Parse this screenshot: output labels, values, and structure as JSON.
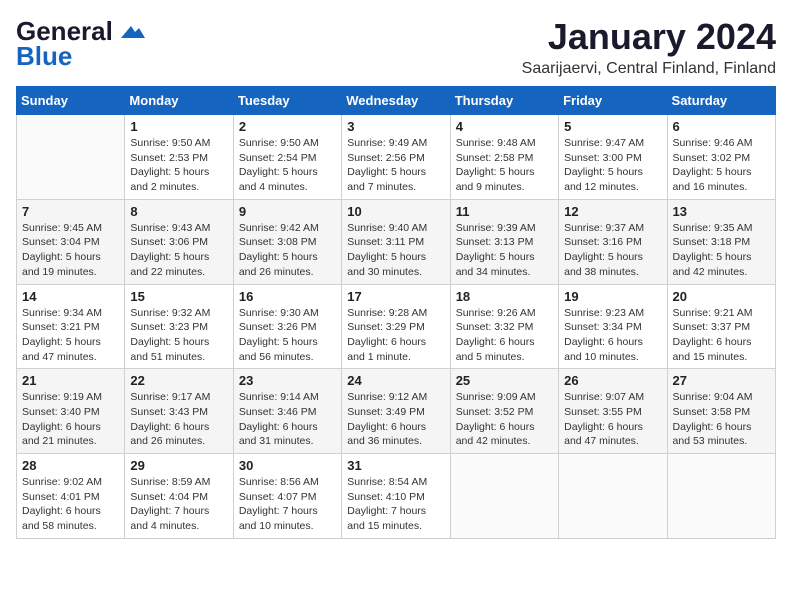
{
  "header": {
    "logo_general": "General",
    "logo_blue": "Blue",
    "main_title": "January 2024",
    "subtitle": "Saarijaervi, Central Finland, Finland"
  },
  "calendar": {
    "days_of_week": [
      "Sunday",
      "Monday",
      "Tuesday",
      "Wednesday",
      "Thursday",
      "Friday",
      "Saturday"
    ],
    "weeks": [
      [
        {
          "day": "",
          "info": ""
        },
        {
          "day": "1",
          "info": "Sunrise: 9:50 AM\nSunset: 2:53 PM\nDaylight: 5 hours\nand 2 minutes."
        },
        {
          "day": "2",
          "info": "Sunrise: 9:50 AM\nSunset: 2:54 PM\nDaylight: 5 hours\nand 4 minutes."
        },
        {
          "day": "3",
          "info": "Sunrise: 9:49 AM\nSunset: 2:56 PM\nDaylight: 5 hours\nand 7 minutes."
        },
        {
          "day": "4",
          "info": "Sunrise: 9:48 AM\nSunset: 2:58 PM\nDaylight: 5 hours\nand 9 minutes."
        },
        {
          "day": "5",
          "info": "Sunrise: 9:47 AM\nSunset: 3:00 PM\nDaylight: 5 hours\nand 12 minutes."
        },
        {
          "day": "6",
          "info": "Sunrise: 9:46 AM\nSunset: 3:02 PM\nDaylight: 5 hours\nand 16 minutes."
        }
      ],
      [
        {
          "day": "7",
          "info": "Sunrise: 9:45 AM\nSunset: 3:04 PM\nDaylight: 5 hours\nand 19 minutes."
        },
        {
          "day": "8",
          "info": "Sunrise: 9:43 AM\nSunset: 3:06 PM\nDaylight: 5 hours\nand 22 minutes."
        },
        {
          "day": "9",
          "info": "Sunrise: 9:42 AM\nSunset: 3:08 PM\nDaylight: 5 hours\nand 26 minutes."
        },
        {
          "day": "10",
          "info": "Sunrise: 9:40 AM\nSunset: 3:11 PM\nDaylight: 5 hours\nand 30 minutes."
        },
        {
          "day": "11",
          "info": "Sunrise: 9:39 AM\nSunset: 3:13 PM\nDaylight: 5 hours\nand 34 minutes."
        },
        {
          "day": "12",
          "info": "Sunrise: 9:37 AM\nSunset: 3:16 PM\nDaylight: 5 hours\nand 38 minutes."
        },
        {
          "day": "13",
          "info": "Sunrise: 9:35 AM\nSunset: 3:18 PM\nDaylight: 5 hours\nand 42 minutes."
        }
      ],
      [
        {
          "day": "14",
          "info": "Sunrise: 9:34 AM\nSunset: 3:21 PM\nDaylight: 5 hours\nand 47 minutes."
        },
        {
          "day": "15",
          "info": "Sunrise: 9:32 AM\nSunset: 3:23 PM\nDaylight: 5 hours\nand 51 minutes."
        },
        {
          "day": "16",
          "info": "Sunrise: 9:30 AM\nSunset: 3:26 PM\nDaylight: 5 hours\nand 56 minutes."
        },
        {
          "day": "17",
          "info": "Sunrise: 9:28 AM\nSunset: 3:29 PM\nDaylight: 6 hours\nand 1 minute."
        },
        {
          "day": "18",
          "info": "Sunrise: 9:26 AM\nSunset: 3:32 PM\nDaylight: 6 hours\nand 5 minutes."
        },
        {
          "day": "19",
          "info": "Sunrise: 9:23 AM\nSunset: 3:34 PM\nDaylight: 6 hours\nand 10 minutes."
        },
        {
          "day": "20",
          "info": "Sunrise: 9:21 AM\nSunset: 3:37 PM\nDaylight: 6 hours\nand 15 minutes."
        }
      ],
      [
        {
          "day": "21",
          "info": "Sunrise: 9:19 AM\nSunset: 3:40 PM\nDaylight: 6 hours\nand 21 minutes."
        },
        {
          "day": "22",
          "info": "Sunrise: 9:17 AM\nSunset: 3:43 PM\nDaylight: 6 hours\nand 26 minutes."
        },
        {
          "day": "23",
          "info": "Sunrise: 9:14 AM\nSunset: 3:46 PM\nDaylight: 6 hours\nand 31 minutes."
        },
        {
          "day": "24",
          "info": "Sunrise: 9:12 AM\nSunset: 3:49 PM\nDaylight: 6 hours\nand 36 minutes."
        },
        {
          "day": "25",
          "info": "Sunrise: 9:09 AM\nSunset: 3:52 PM\nDaylight: 6 hours\nand 42 minutes."
        },
        {
          "day": "26",
          "info": "Sunrise: 9:07 AM\nSunset: 3:55 PM\nDaylight: 6 hours\nand 47 minutes."
        },
        {
          "day": "27",
          "info": "Sunrise: 9:04 AM\nSunset: 3:58 PM\nDaylight: 6 hours\nand 53 minutes."
        }
      ],
      [
        {
          "day": "28",
          "info": "Sunrise: 9:02 AM\nSunset: 4:01 PM\nDaylight: 6 hours\nand 58 minutes."
        },
        {
          "day": "29",
          "info": "Sunrise: 8:59 AM\nSunset: 4:04 PM\nDaylight: 7 hours\nand 4 minutes."
        },
        {
          "day": "30",
          "info": "Sunrise: 8:56 AM\nSunset: 4:07 PM\nDaylight: 7 hours\nand 10 minutes."
        },
        {
          "day": "31",
          "info": "Sunrise: 8:54 AM\nSunset: 4:10 PM\nDaylight: 7 hours\nand 15 minutes."
        },
        {
          "day": "",
          "info": ""
        },
        {
          "day": "",
          "info": ""
        },
        {
          "day": "",
          "info": ""
        }
      ]
    ]
  }
}
